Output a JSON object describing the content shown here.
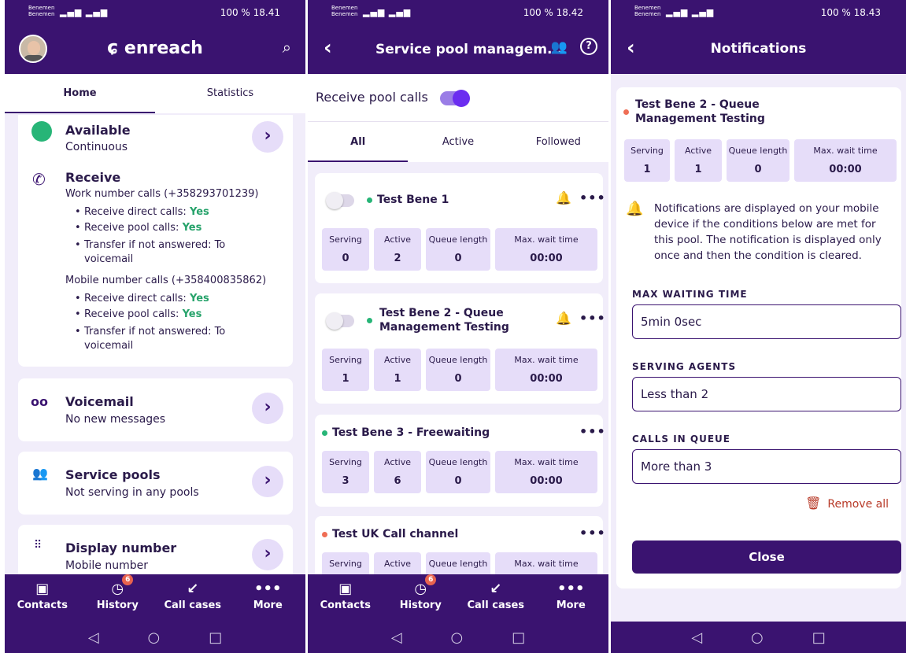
{
  "status": {
    "carrier": "Benemen",
    "s1": {
      "right": "100 %  18.41"
    },
    "s2": {
      "right": "100 %  18.42"
    },
    "s3": {
      "right": "100 %  18.43"
    }
  },
  "screen1": {
    "brand": "enreach",
    "tabs": [
      "Home",
      "Statistics"
    ],
    "available": {
      "title": "Available",
      "sub": "Continuous"
    },
    "receive": {
      "title": "Receive",
      "work": "Work number calls (+358293701239)",
      "mobile": "Mobile number calls (+358400835862)",
      "direct_label": "Receive direct calls:",
      "pool_label": "Receive pool calls:",
      "yes": "Yes",
      "transfer1": "Transfer if not answered: To",
      "transfer2": "voicemail"
    },
    "voicemail": {
      "title": "Voicemail",
      "sub": "No new messages"
    },
    "service_pools": {
      "title": "Service pools",
      "sub": "Not serving in any pools"
    },
    "display_number": {
      "title": "Display number",
      "sub": "Mobile number"
    }
  },
  "bottom_nav": {
    "items": [
      "Contacts",
      "History",
      "Call cases",
      "More"
    ],
    "history_badge": "6"
  },
  "screen2": {
    "title": "Service pool managem...",
    "receive_pool_calls": "Receive pool calls",
    "tabs": [
      "All",
      "Active",
      "Followed"
    ],
    "stat_labels": [
      "Serving",
      "Active",
      "Queue length",
      "Max. wait time"
    ],
    "pools": [
      {
        "name": "Test Bene 1",
        "values": [
          "0",
          "2",
          "0",
          "00:00"
        ]
      },
      {
        "name1": "Test Bene 2 - Queue",
        "name2": "Management Testing",
        "values": [
          "1",
          "1",
          "0",
          "00:00"
        ]
      },
      {
        "name": "Test Bene 3 - Freewaiting",
        "values": [
          "3",
          "6",
          "0",
          "00:00"
        ]
      },
      {
        "name": "Test UK Call channel"
      }
    ]
  },
  "screen3": {
    "title": "Notifications",
    "pool_name1": "Test Bene 2 - Queue",
    "pool_name2": "Management Testing",
    "stat_labels": [
      "Serving",
      "Active",
      "Queue length",
      "Max. wait time"
    ],
    "values": [
      "1",
      "1",
      "0",
      "00:00"
    ],
    "info_lines": [
      "Notifications are displayed on your mobile",
      "device if the conditions below are met for",
      "this pool. The notification is displayed only",
      "once and then the condition is cleared."
    ],
    "max_waiting_label": "MAX WAITING TIME",
    "max_waiting_value": "5min 0sec",
    "serving_label": "SERVING AGENTS",
    "serving_value": "Less than 2",
    "queue_label": "CALLS IN QUEUE",
    "queue_value": "More than 3",
    "remove_all": "Remove all",
    "close": "Close"
  },
  "colors": {
    "brand": "#3a1370",
    "accent": "#6b2df0",
    "green": "#27a36b",
    "alert": "#d3482f"
  }
}
